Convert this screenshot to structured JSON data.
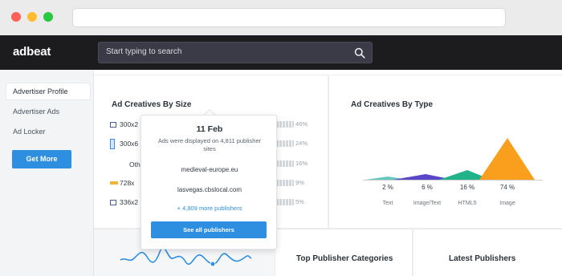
{
  "app": {
    "logo": "adbeat"
  },
  "search": {
    "placeholder": "Start typing to search"
  },
  "sidebar": {
    "items": [
      {
        "label": "Advertiser Profile",
        "active": true
      },
      {
        "label": "Advertiser Ads",
        "active": false
      },
      {
        "label": "Ad Locker",
        "active": false
      }
    ],
    "cta_label": "Get More"
  },
  "size_panel": {
    "title": "Ad Creatives By Size",
    "rows": [
      {
        "label": "300x2",
        "pct": "46%"
      },
      {
        "label": "300x6",
        "pct": "24%"
      },
      {
        "label": "Oth",
        "pct": "16%"
      },
      {
        "label": "728x",
        "pct": "9%"
      },
      {
        "label": "336x2",
        "pct": "5%"
      }
    ]
  },
  "type_panel": {
    "title": "Ad Creatives By Type",
    "types": [
      {
        "label": "Text",
        "pct": "2 %",
        "color": "#46c0b0"
      },
      {
        "label": "Image/Text",
        "pct": "6 %",
        "color": "#5a47c8"
      },
      {
        "label": "HTML5",
        "pct": "16 %",
        "color": "#22b38a"
      },
      {
        "label": "Image",
        "pct": "74 %",
        "color": "#fa9e1e"
      }
    ]
  },
  "tooltip": {
    "date": "11 Feb",
    "description": "Ads were displayed on 4,811 publisher sites",
    "publishers": [
      "medieval-europe.eu",
      "lasvegas.cbslocal.com"
    ],
    "more_link": "+ 4,809 more publishers",
    "button_label": "See all publishers"
  },
  "bottom": {
    "categories_title": "Top Publisher Categories",
    "latest_title": "Latest Publishers"
  },
  "colors": {
    "accent": "#2e8ee0",
    "header": "#1c1c1e"
  }
}
